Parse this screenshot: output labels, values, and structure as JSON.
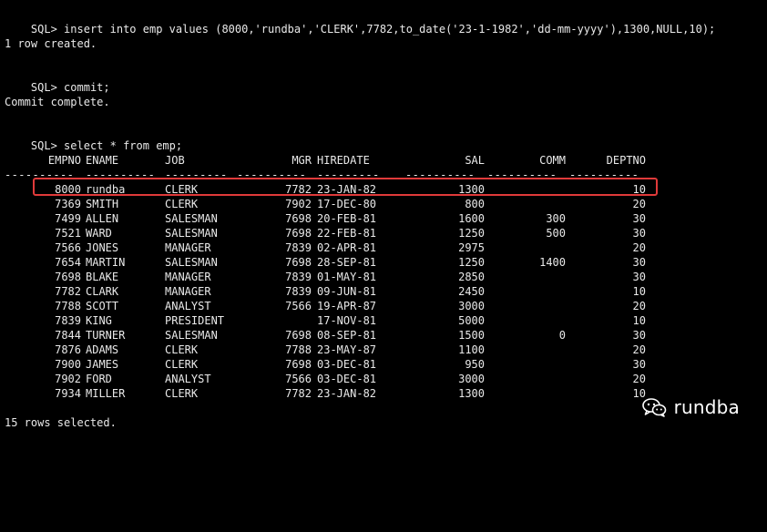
{
  "terminal": {
    "prompt": "SQL>",
    "commands": {
      "insert": "insert into emp values (8000,'rundba','CLERK',7782,to_date('23-1-1982','dd-mm-yyyy'),1300,NULL,10);",
      "commit": "commit;",
      "select": "select * from emp;"
    },
    "messages": {
      "row_created": "1 row created.",
      "commit_complete": "Commit complete.",
      "rows_selected": "15 rows selected."
    },
    "colors": {
      "background": "#000000",
      "text": "#e9e9e9",
      "highlight_border": "#e03a3a"
    }
  },
  "table": {
    "headers": {
      "empno": "EMPNO",
      "ename": "ENAME",
      "job": "JOB",
      "mgr": "MGR",
      "hiredate": "HIREDATE",
      "sal": "SAL",
      "comm": "COMM",
      "deptno": "DEPTNO"
    },
    "separator": {
      "empno": "----------",
      "ename": "----------",
      "job": "---------",
      "mgr": "----------",
      "hiredate": "---------",
      "sal": "----------",
      "comm": "----------",
      "deptno": "----------"
    },
    "rows": [
      {
        "empno": "8000",
        "ename": "rundba",
        "job": "CLERK",
        "mgr": "7782",
        "hiredate": "23-JAN-82",
        "sal": "1300",
        "comm": "",
        "deptno": "10"
      },
      {
        "empno": "7369",
        "ename": "SMITH",
        "job": "CLERK",
        "mgr": "7902",
        "hiredate": "17-DEC-80",
        "sal": "800",
        "comm": "",
        "deptno": "20"
      },
      {
        "empno": "7499",
        "ename": "ALLEN",
        "job": "SALESMAN",
        "mgr": "7698",
        "hiredate": "20-FEB-81",
        "sal": "1600",
        "comm": "300",
        "deptno": "30"
      },
      {
        "empno": "7521",
        "ename": "WARD",
        "job": "SALESMAN",
        "mgr": "7698",
        "hiredate": "22-FEB-81",
        "sal": "1250",
        "comm": "500",
        "deptno": "30"
      },
      {
        "empno": "7566",
        "ename": "JONES",
        "job": "MANAGER",
        "mgr": "7839",
        "hiredate": "02-APR-81",
        "sal": "2975",
        "comm": "",
        "deptno": "20"
      },
      {
        "empno": "7654",
        "ename": "MARTIN",
        "job": "SALESMAN",
        "mgr": "7698",
        "hiredate": "28-SEP-81",
        "sal": "1250",
        "comm": "1400",
        "deptno": "30"
      },
      {
        "empno": "7698",
        "ename": "BLAKE",
        "job": "MANAGER",
        "mgr": "7839",
        "hiredate": "01-MAY-81",
        "sal": "2850",
        "comm": "",
        "deptno": "30"
      },
      {
        "empno": "7782",
        "ename": "CLARK",
        "job": "MANAGER",
        "mgr": "7839",
        "hiredate": "09-JUN-81",
        "sal": "2450",
        "comm": "",
        "deptno": "10"
      },
      {
        "empno": "7788",
        "ename": "SCOTT",
        "job": "ANALYST",
        "mgr": "7566",
        "hiredate": "19-APR-87",
        "sal": "3000",
        "comm": "",
        "deptno": "20"
      },
      {
        "empno": "7839",
        "ename": "KING",
        "job": "PRESIDENT",
        "mgr": "",
        "hiredate": "17-NOV-81",
        "sal": "5000",
        "comm": "",
        "deptno": "10"
      },
      {
        "empno": "7844",
        "ename": "TURNER",
        "job": "SALESMAN",
        "mgr": "7698",
        "hiredate": "08-SEP-81",
        "sal": "1500",
        "comm": "0",
        "deptno": "30"
      },
      {
        "empno": "7876",
        "ename": "ADAMS",
        "job": "CLERK",
        "mgr": "7788",
        "hiredate": "23-MAY-87",
        "sal": "1100",
        "comm": "",
        "deptno": "20"
      },
      {
        "empno": "7900",
        "ename": "JAMES",
        "job": "CLERK",
        "mgr": "7698",
        "hiredate": "03-DEC-81",
        "sal": "950",
        "comm": "",
        "deptno": "30"
      },
      {
        "empno": "7902",
        "ename": "FORD",
        "job": "ANALYST",
        "mgr": "7566",
        "hiredate": "03-DEC-81",
        "sal": "3000",
        "comm": "",
        "deptno": "20"
      },
      {
        "empno": "7934",
        "ename": "MILLER",
        "job": "CLERK",
        "mgr": "7782",
        "hiredate": "23-JAN-82",
        "sal": "1300",
        "comm": "",
        "deptno": "10"
      }
    ]
  },
  "watermark": {
    "icon": "wechat-icon",
    "text": "rundba"
  }
}
